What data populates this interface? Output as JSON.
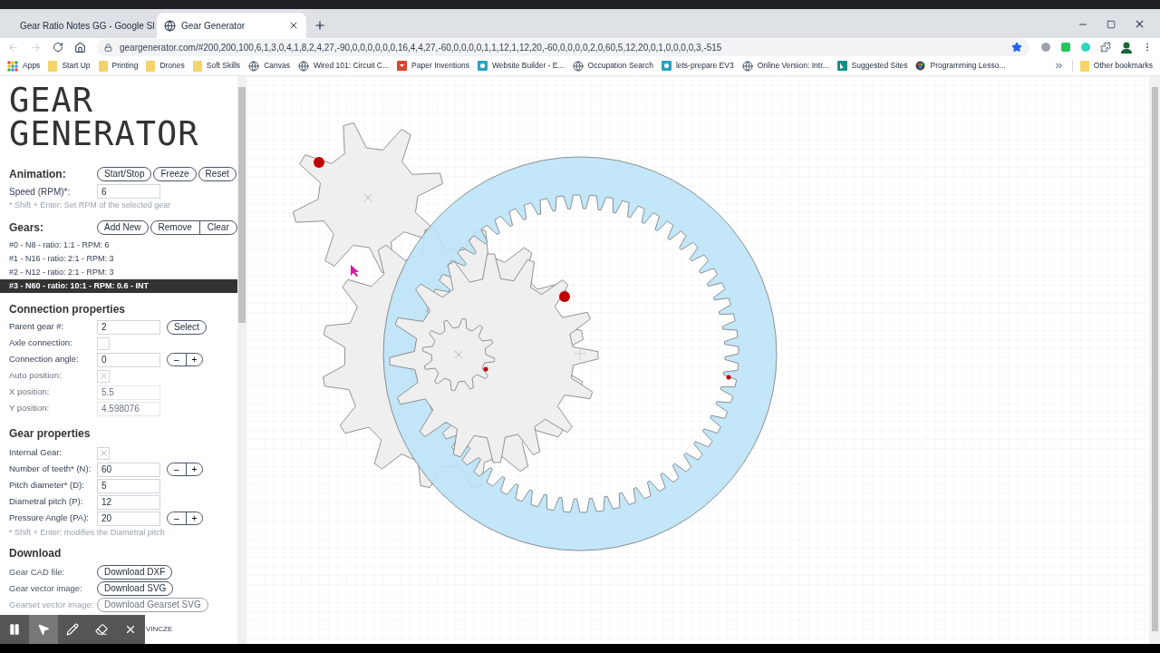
{
  "browser": {
    "tabs": [
      {
        "title": "Gear Ratio Notes GG - Google Sl",
        "kind": "slides",
        "selected": false
      },
      {
        "title": "Gear Generator",
        "kind": "globe",
        "selected": true
      }
    ],
    "url": "geargenerator.com/#200,200,100,6,1,3,0,4,1,8,2,4,27,-90,0,0,0,0,0,0,16,4,4,27,-60,0,0,0,0,1,1,12,1,12,20,-60,0,0,0,0,2,0,60,5,12,20,0,1,0,0,0,0,3,-515",
    "bookmarks": [
      {
        "label": "Apps",
        "kind": "apps"
      },
      {
        "label": "Start Up",
        "kind": "folder"
      },
      {
        "label": "Printing",
        "kind": "folder"
      },
      {
        "label": "Drones",
        "kind": "folder"
      },
      {
        "label": "Soft Skills",
        "kind": "folder"
      },
      {
        "label": "Canvas",
        "kind": "globe"
      },
      {
        "label": "Wired 101: Circuit C...",
        "kind": "globe"
      },
      {
        "label": "Paper Inventions",
        "kind": "red"
      },
      {
        "label": "Website Builder - E...",
        "kind": "teal"
      },
      {
        "label": "Occupation Search",
        "kind": "globe"
      },
      {
        "label": "lets-prepare EV3",
        "kind": "teal"
      },
      {
        "label": "Online Version: Intr...",
        "kind": "globe"
      },
      {
        "label": "Suggested Sites",
        "kind": "bing"
      },
      {
        "label": "Programming Lesso...",
        "kind": "color"
      }
    ],
    "other_bookmarks": "Other bookmarks"
  },
  "logo": [
    "GEAR",
    "GENERATOR"
  ],
  "animation": {
    "heading": "Animation:",
    "buttons": [
      "Start/Stop",
      "Freeze",
      "Reset"
    ],
    "speed_label": "Speed (RPM)*:",
    "speed_value": "6",
    "hint": "* Shift + Enter: Set RPM of the selected gear"
  },
  "gears": {
    "heading": "Gears:",
    "buttons": [
      "Add New",
      "Remove",
      "Clear"
    ],
    "items": [
      {
        "label": "#0 - N8 - ratio: 1:1 - RPM: 6",
        "selected": false
      },
      {
        "label": "#1 - N16 - ratio: 2:1 - RPM: 3",
        "selected": false
      },
      {
        "label": "#2 - N12 - ratio: 2:1 - RPM: 3",
        "selected": false
      },
      {
        "label": "#3 - N60 - ratio: 10:1 - RPM: 0.6 - INT",
        "selected": true
      }
    ]
  },
  "connection": {
    "heading": "Connection properties",
    "rows": [
      {
        "kind": "field",
        "label": "Parent gear #:",
        "value": "2",
        "button": "Select",
        "disabled": false
      },
      {
        "kind": "checkbox",
        "label": "Axle connection:",
        "checked": false,
        "disabled": false
      },
      {
        "kind": "stepper",
        "label": "Connection angle:",
        "value": "0",
        "minus": "–",
        "plus": "+",
        "disabled": false
      },
      {
        "kind": "checkbox",
        "label": "Auto position:",
        "checked": true,
        "disabled": true
      },
      {
        "kind": "field",
        "label": "X position:",
        "value": "5.5",
        "disabled": true
      },
      {
        "kind": "field",
        "label": "Y position:",
        "value": "4.598076",
        "disabled": true
      }
    ]
  },
  "gear_props": {
    "heading": "Gear properties",
    "rows": [
      {
        "kind": "checkbox",
        "label": "Internal Gear:",
        "checked": true,
        "disabled": false
      },
      {
        "kind": "stepper",
        "label": "Number of teeth* (N):",
        "value": "60",
        "minus": "–",
        "plus": "+",
        "disabled": false
      },
      {
        "kind": "field",
        "label": "Pitch diameter* (D):",
        "value": "5",
        "disabled": false
      },
      {
        "kind": "field",
        "label": "Diametral pitch (P):",
        "value": "12",
        "disabled": false
      },
      {
        "kind": "stepper",
        "label": "Pressure Angle (PA):",
        "value": "20",
        "minus": "–",
        "plus": "+",
        "disabled": false
      }
    ],
    "hint": "* Shift + Enter: modifies the Diametral pitch"
  },
  "download": {
    "heading": "Download",
    "rows": [
      {
        "label": "Gear CAD file:",
        "button": "Download DXF",
        "disabled": false
      },
      {
        "label": "Gear vector image:",
        "button": "Download SVG",
        "disabled": false
      },
      {
        "label": "Gearset vector image:",
        "button": "Download Gearset SVG",
        "disabled": true
      }
    ]
  },
  "footer_text": "VINCZE",
  "tools": [
    {
      "kind": "pause",
      "selected": false
    },
    {
      "kind": "pointer",
      "selected": true
    },
    {
      "kind": "pencil",
      "selected": false
    },
    {
      "kind": "eraser",
      "selected": false
    },
    {
      "kind": "close",
      "selected": false
    }
  ]
}
